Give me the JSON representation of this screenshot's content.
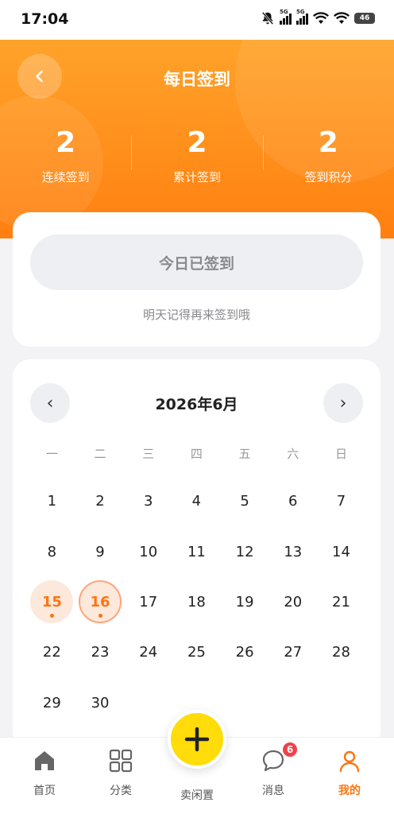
{
  "status_bar": {
    "time": "17:04",
    "signal_label_1": "5G",
    "signal_label_2": "5G",
    "battery": "46",
    "icons": [
      "bell-muted-icon",
      "signal-icon",
      "signal-icon",
      "wifi-icon",
      "wifi-icon",
      "battery-icon"
    ]
  },
  "header": {
    "title": "每日签到",
    "back_icon": "chevron-left-icon",
    "stats": [
      {
        "value": "2",
        "label": "连续签到"
      },
      {
        "value": "2",
        "label": "累计签到"
      },
      {
        "value": "2",
        "label": "签到积分"
      }
    ]
  },
  "checkin": {
    "button_label": "今日已签到",
    "tip": "明天记得再来签到哦"
  },
  "calendar": {
    "title": "2026年6月",
    "prev_label": "‹",
    "next_label": "›",
    "weekdays": [
      "一",
      "二",
      "三",
      "四",
      "五",
      "六",
      "日"
    ],
    "weeks": [
      [
        "1",
        "2",
        "3",
        "4",
        "5",
        "6",
        "7"
      ],
      [
        "8",
        "9",
        "10",
        "11",
        "12",
        "13",
        "14"
      ],
      [
        "15",
        "16",
        "17",
        "18",
        "19",
        "20",
        "21"
      ],
      [
        "22",
        "23",
        "24",
        "25",
        "26",
        "27",
        "28"
      ],
      [
        "29",
        "30"
      ]
    ],
    "signed_days": [
      "15",
      "16"
    ],
    "today": "16"
  },
  "bottom_nav": {
    "items": [
      {
        "label": "首页",
        "icon": "home-icon"
      },
      {
        "label": "分类",
        "icon": "grid-icon"
      },
      {
        "label": "消息",
        "icon": "chat-bubble-icon",
        "badge": "6"
      },
      {
        "label": "我的",
        "icon": "user-icon",
        "active": true
      }
    ],
    "fab_label": "卖闲置",
    "fab_icon": "plus-icon"
  },
  "colors": {
    "accent": "#ff7410",
    "header_gradient_top": "#ffa32a",
    "header_gradient_bottom": "#ff7f10",
    "fab": "#ffdc0a",
    "badge": "#f2404a"
  }
}
